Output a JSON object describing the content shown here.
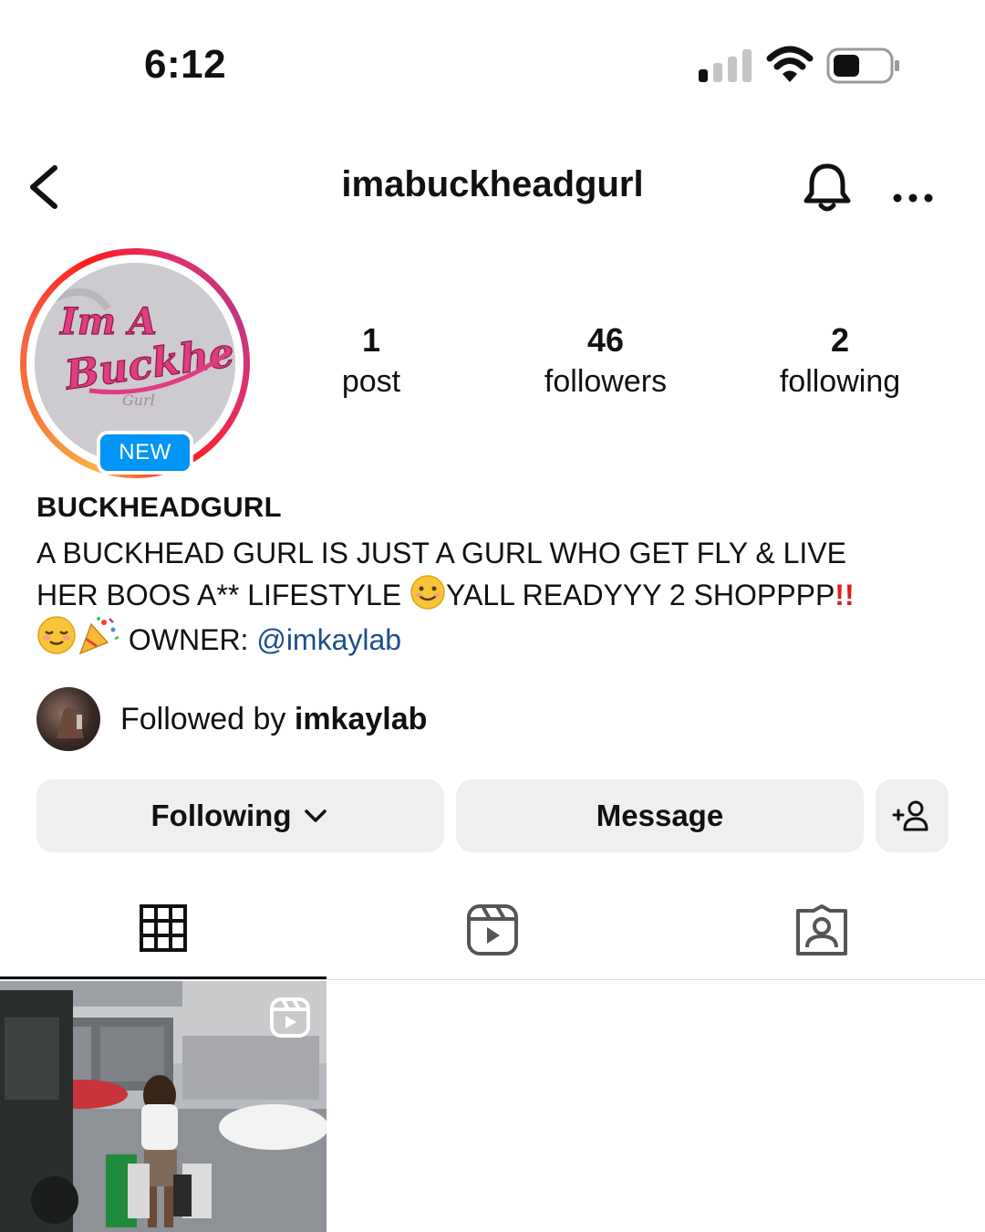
{
  "status_bar": {
    "time": "6:12"
  },
  "header": {
    "username": "imabuckheadgurl"
  },
  "avatar": {
    "badge": "NEW"
  },
  "stats": [
    {
      "value": "1",
      "label": "post"
    },
    {
      "value": "46",
      "label": "followers"
    },
    {
      "value": "2",
      "label": "following"
    }
  ],
  "profile": {
    "display_name": "BUCKHEADGURL",
    "bio_line1": "A BUCKHEAD GURL IS JUST A GURL WHO GET FLY & LIVE",
    "bio_line2_a": "HER BOOS A** LIFESTYLE ",
    "bio_emoji_smile": "😊",
    "bio_line2_b": "YALL READYYY 2 SHOPPPP",
    "bio_bangs": "‼️",
    "bio_emoji_relieved": "☺️",
    "bio_emoji_party": "🎉",
    "bio_owner": " OWNER: ",
    "bio_mention": "@imkaylab"
  },
  "followed_by": {
    "prefix": "Followed by ",
    "username": "imkaylab"
  },
  "actions": {
    "following_label": "Following",
    "message_label": "Message"
  },
  "tabs": [
    "grid-icon",
    "reels-icon",
    "tagged-icon"
  ],
  "colors": {
    "accent_blue": "#0095f6",
    "mention": "#1e4d8f",
    "button_bg": "#efefef"
  }
}
